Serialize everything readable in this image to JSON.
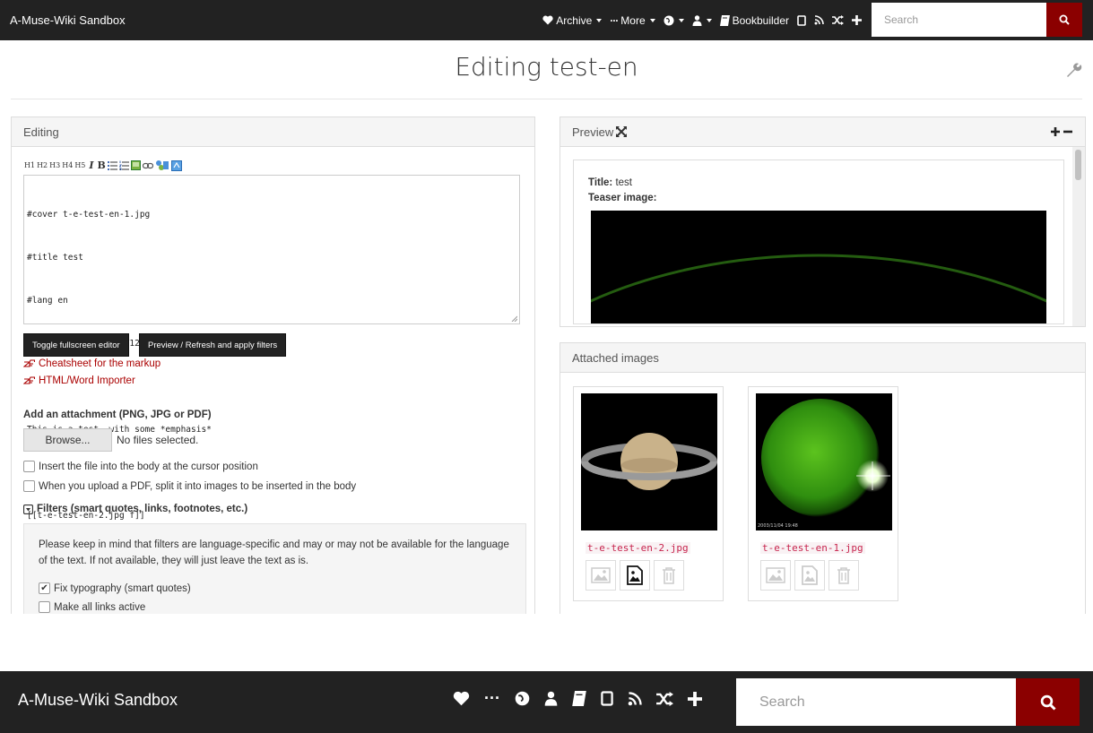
{
  "nav": {
    "brand": "A-Muse-Wiki Sandbox",
    "archive_label": "Archive",
    "more_label": "More",
    "bookbuilder_label": "Bookbuilder",
    "search_placeholder": "Search"
  },
  "page": {
    "title": "Editing test-en"
  },
  "editing": {
    "heading": "Editing",
    "toolbar": [
      "H1",
      "H2",
      "H3",
      "H4",
      "H5",
      "I",
      "B"
    ],
    "text_lines": [
      "#cover t-e-test-en-1.jpg",
      "#title test",
      "#lang en",
      "#pubdate 2018-08-27T12:55:10",
      "",
      "This is a test, with some *emphasis*",
      "",
      "[[t-e-test-en-2.jpg f]]"
    ],
    "toggle_fullscreen": "Toggle fullscreen editor",
    "preview_refresh": "Preview / Refresh and apply filters",
    "cheatsheet_link": "Cheatsheet for the markup",
    "importer_link": "HTML/Word Importer",
    "attachment_label": "Add an attachment (PNG, JPG or PDF)",
    "browse_label": "Browse...",
    "no_files": "No files selected.",
    "insert_file_label": "Insert the file into the body at the cursor position",
    "split_pdf_label": "When you upload a PDF, split it into images to be inserted in the body",
    "filters_label": "Filters (smart quotes, links, footnotes, etc.)",
    "filters_note": "Please keep in mind that filters are language-specific and may or may not be available for the language of the text. If not available, they will just leave the text as is.",
    "fix_typography_label": "Fix typography (smart quotes)",
    "make_links_label": "Make all links active"
  },
  "preview": {
    "heading": "Preview",
    "title_key": "Title:",
    "title_value": "test",
    "teaser_key": "Teaser image:"
  },
  "attached": {
    "heading": "Attached images",
    "images": [
      {
        "filename": "t-e-test-en-2.jpg"
      },
      {
        "filename": "t-e-test-en-1.jpg",
        "stamp": "2003/11/04 19:48"
      }
    ]
  },
  "colors": {
    "navbar": "#222222",
    "accent": "#8b0000",
    "link": "#aa0000"
  }
}
